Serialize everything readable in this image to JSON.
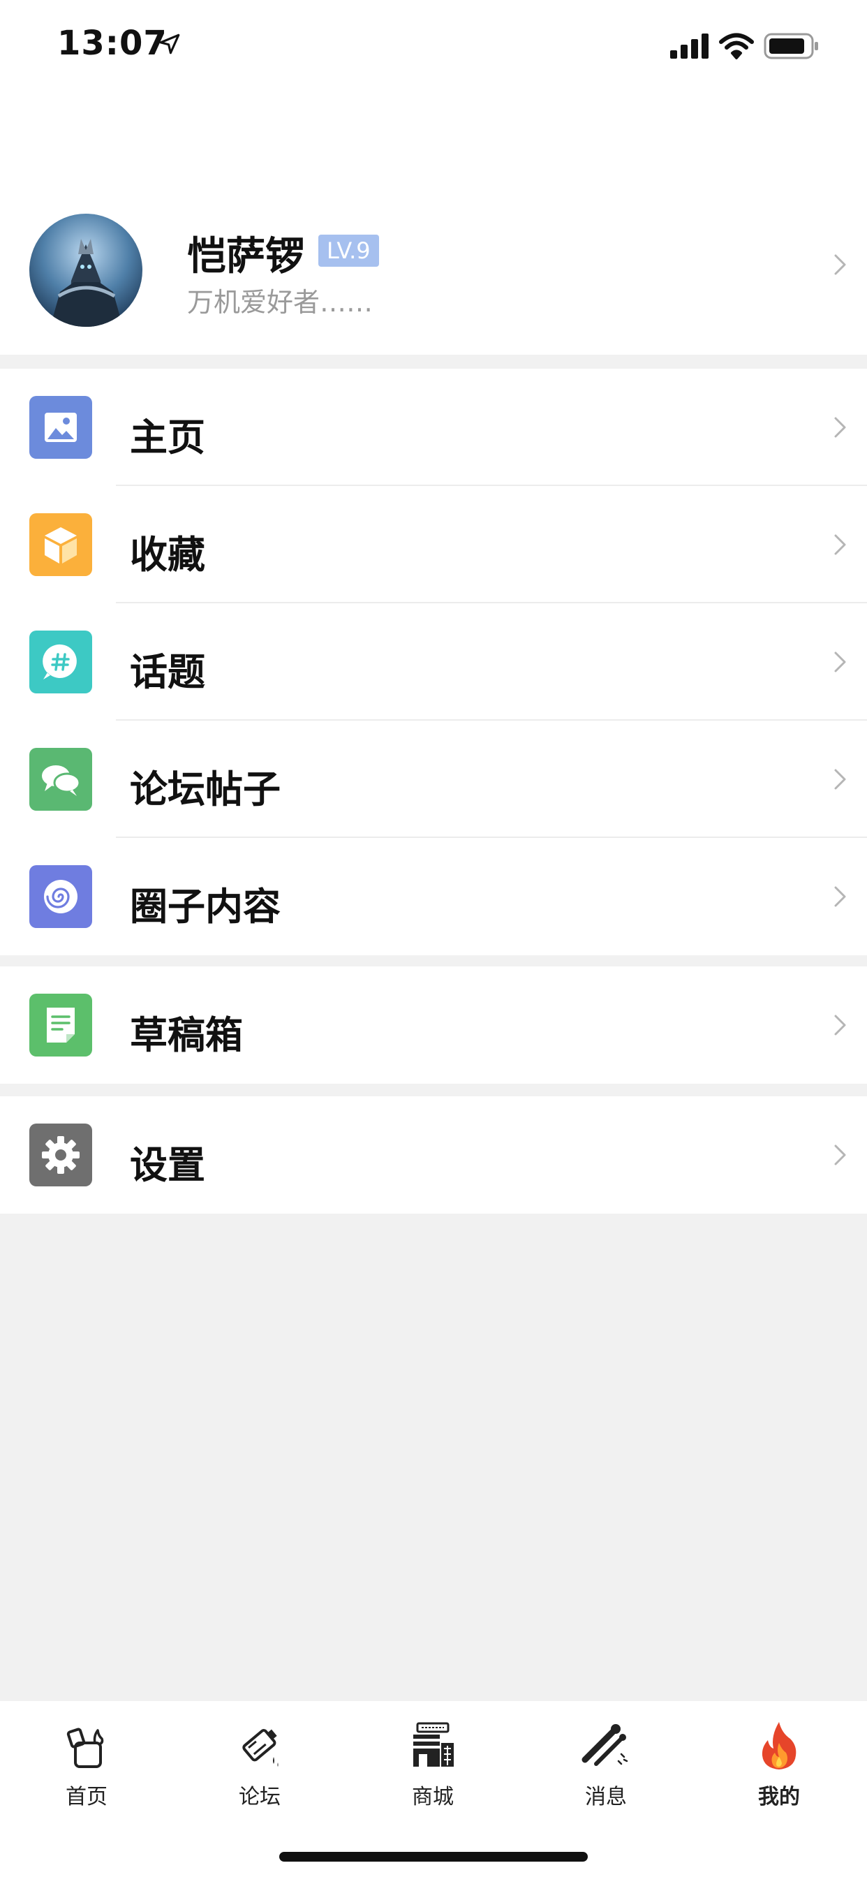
{
  "status_bar": {
    "time": "13:07"
  },
  "profile": {
    "name": "恺萨锣",
    "level": "LV.9",
    "bio": "万机爱好者……"
  },
  "menu_main": [
    {
      "id": "home",
      "label": "主页",
      "icon": "image-icon",
      "color": "#6c8bdc"
    },
    {
      "id": "favorites",
      "label": "收藏",
      "icon": "box-icon",
      "color": "#fbb03b"
    },
    {
      "id": "topics",
      "label": "话题",
      "icon": "hashtag-bubble-icon",
      "color": "#3dc9c4"
    },
    {
      "id": "forum-posts",
      "label": "论坛帖子",
      "icon": "chat-bubbles-icon",
      "color": "#5ab872"
    },
    {
      "id": "circle-content",
      "label": "圈子内容",
      "icon": "spiral-icon",
      "color": "#6f7de0"
    }
  ],
  "menu_drafts": {
    "label": "草稿箱",
    "icon": "note-icon",
    "color": "#5cbf6b"
  },
  "menu_settings": {
    "label": "设置",
    "icon": "gear-icon",
    "color": "#6f6f6f"
  },
  "tabbar": [
    {
      "label": "首页",
      "icon": "lighter-icon",
      "active": false
    },
    {
      "label": "论坛",
      "icon": "spray-can-icon",
      "active": false
    },
    {
      "label": "商城",
      "icon": "store-icon",
      "active": false
    },
    {
      "label": "消息",
      "icon": "matches-icon",
      "active": false
    },
    {
      "label": "我的",
      "icon": "flame-icon",
      "active": true
    }
  ]
}
